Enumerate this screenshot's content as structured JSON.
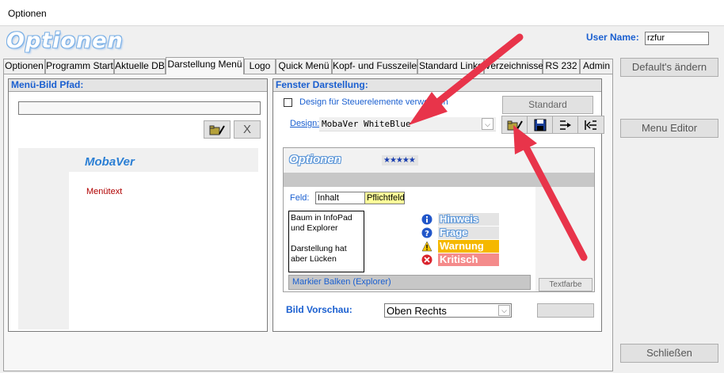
{
  "window": {
    "title": "Optionen"
  },
  "header": {
    "app_title": "Optionen",
    "user_label": "User Name:",
    "user_value": "rzfur"
  },
  "tabs": [
    {
      "label": "Optionen"
    },
    {
      "label": "Programm Start"
    },
    {
      "label": "Aktuelle DB"
    },
    {
      "label": "Darstellung Menü",
      "active": true
    },
    {
      "label": "Logo"
    },
    {
      "label": "Quick Menü"
    },
    {
      "label": "Kopf- und Fusszeilen"
    },
    {
      "label": "Standard Links"
    },
    {
      "label": "Verzeichnisse"
    },
    {
      "label": "RS 232"
    },
    {
      "label": "Admin"
    }
  ],
  "left_panel": {
    "title": "Menü-Bild Pfad:",
    "path_value": "",
    "clear_label": "X",
    "preview_title": "MobaVer",
    "preview_menu_text": "Menütext"
  },
  "right_panel": {
    "title": "Fenster Darstellung:",
    "checkbox_label": "Design für Steuerelemente verwenden",
    "standard_label": "Standard",
    "design_label": "Design:",
    "design_value": "MobaVer WhiteBlue",
    "preview": {
      "title": "Optionen",
      "stars": "★★★★★",
      "field_label": "Feld:",
      "field_value": "Inhalt",
      "required_value": "Pflichtfeld",
      "tree_text_1": "Baum in InfoPad",
      "tree_text_2": "und Explorer",
      "tree_text_3": "Darstellung hat",
      "tree_text_4": "aber Lücken",
      "hint": "Hinweis",
      "question": "Frage",
      "warning": "Warnung",
      "critical": "Kritisch",
      "marker_bar": "Markier Balken (Explorer)",
      "text_color_button": "Textfarbe"
    },
    "image_preview_label": "Bild Vorschau:",
    "image_preview_value": "Oben Rechts"
  },
  "sidebar": {
    "defaults_button": "Default's ändern",
    "menu_editor_button": "Menu Editor",
    "close_button": "Schließen"
  },
  "colors": {
    "accent": "#1a5fd0",
    "arrow": "#e8344a",
    "required": "#ffff99",
    "warning": "#f5b800",
    "critical": "#f48b8b"
  }
}
